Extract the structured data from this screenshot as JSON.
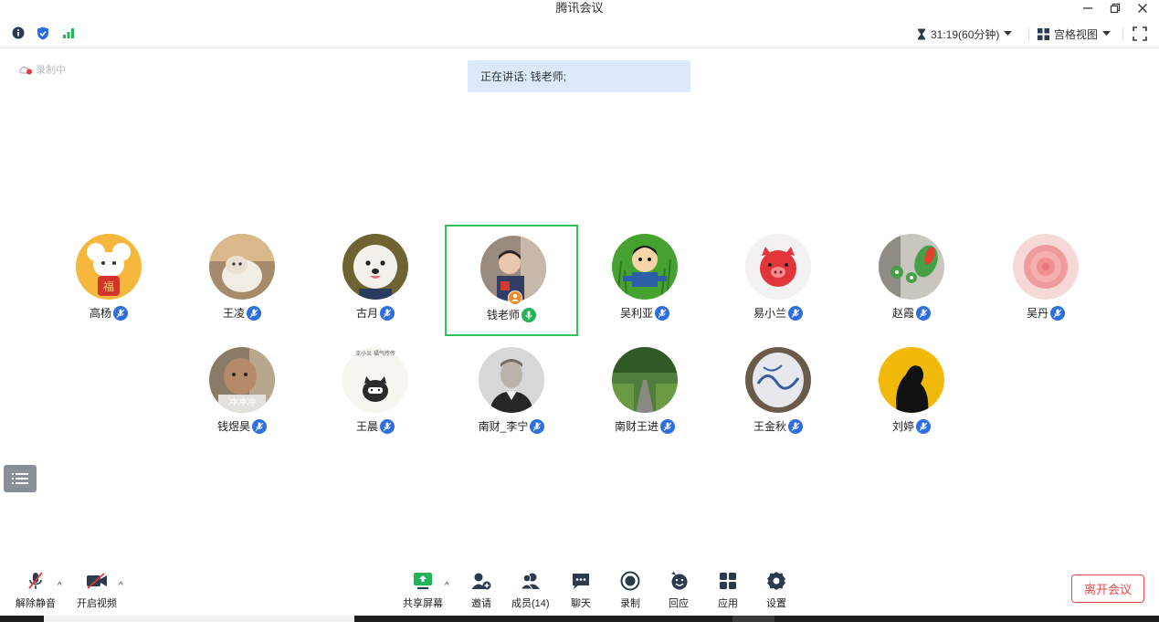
{
  "window": {
    "title": "腾讯会议"
  },
  "infobar": {
    "timer_text": "31:19(60分钟)",
    "view_mode": "宫格视图"
  },
  "status": {
    "recording": "录制中",
    "speaking": "正在讲话: 钱老师;"
  },
  "participants": [
    {
      "name": "高杨",
      "avatar": "cartoon-mouse-avatar",
      "bg": "#f5b73c"
    },
    {
      "name": "王凌",
      "avatar": "cat-photo-avatar",
      "bg": "#b79a7a"
    },
    {
      "name": "古月",
      "avatar": "dog-photo-avatar",
      "bg": "#7c6a3c"
    },
    {
      "name": "钱老师",
      "avatar": "child-photo-avatar",
      "bg": "#8e7d70",
      "speaking": true
    },
    {
      "name": "吴利亚",
      "avatar": "cartoon-boy-avatar",
      "bg": "#3e9b2a"
    },
    {
      "name": "易小兰",
      "avatar": "pig-avatar",
      "bg": "#f3f1f1"
    },
    {
      "name": "赵霞",
      "avatar": "frog-toy-avatar",
      "bg": "#c9c6c0"
    },
    {
      "name": "吴丹",
      "avatar": "rose-avatar",
      "bg": "#f3c6c6"
    },
    {
      "name": "钱煜昊",
      "avatar": "baby-photo-avatar",
      "bg": "#9a8a76",
      "overlay": "冲冲冲"
    },
    {
      "name": "王晨",
      "avatar": "cartoon-cat-avatar",
      "bg": "#f6f5f0",
      "overlay_top": "王小兰 福气传传"
    },
    {
      "name": "南财_李宁",
      "avatar": "portrait-avatar",
      "bg": "#dcdcdc"
    },
    {
      "name": "南财王进",
      "avatar": "road-photo-avatar",
      "bg": "#5e8a4c"
    },
    {
      "name": "王金秋",
      "avatar": "porcelain-avatar",
      "bg": "#c7c9cf"
    },
    {
      "name": "刘婷",
      "avatar": "silhouette-avatar",
      "bg": "#f1b90a"
    }
  ],
  "toolbar": {
    "unmute": "解除静音",
    "start_video": "开启视频",
    "share_screen": "共享屏幕",
    "invite": "邀请",
    "members": "成员(14)",
    "chat": "聊天",
    "record": "录制",
    "reaction": "回应",
    "apps": "应用",
    "settings": "设置",
    "leave": "离开会议"
  },
  "colors": {
    "accent": "#2d6fe0",
    "speaking_border": "#2fc35a",
    "leave": "#e84a4a",
    "banner": "#dbe9fb"
  }
}
